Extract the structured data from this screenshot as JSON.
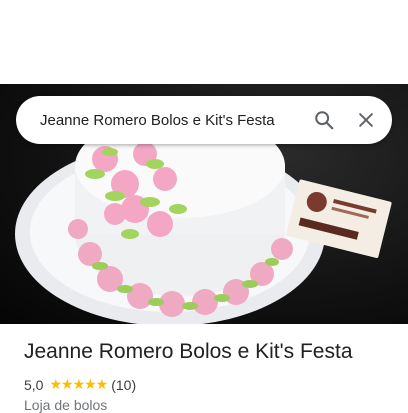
{
  "search": {
    "query": "Jeanne Romero Bolos e Kit's Festa"
  },
  "place": {
    "title": "Jeanne Romero Bolos e Kit's Festa",
    "rating": "5,0",
    "stars": "★★★★★",
    "review_count": "(10)",
    "category": "Loja de bolos"
  },
  "icons": {
    "search": "search-icon",
    "clear": "close-icon"
  },
  "colors": {
    "star": "#fbbc04",
    "text": "#202124",
    "subtle": "#70757a"
  }
}
